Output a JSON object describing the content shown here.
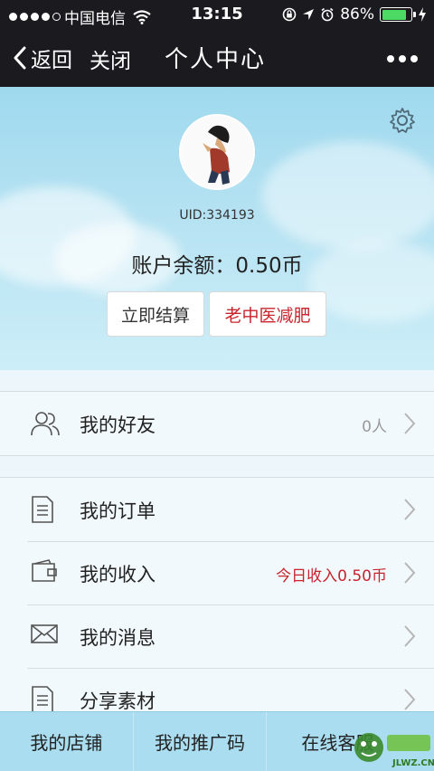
{
  "status_bar": {
    "carrier": "中国电信",
    "time": "13:15",
    "battery": "86%",
    "battery_level": 0.86
  },
  "nav": {
    "back_label": "返回",
    "close_label": "关闭",
    "title": "个人中心"
  },
  "profile": {
    "uid": "UID:334193",
    "balance": "账户余额：0.50币",
    "settle_label": "立即结算",
    "doctor_label": "老中医减肥"
  },
  "menu": {
    "friends": {
      "label": "我的好友",
      "value": "0人"
    },
    "orders": {
      "label": "我的订单"
    },
    "income": {
      "label": "我的收入",
      "value": "今日收入0.50币"
    },
    "messages": {
      "label": "我的消息"
    },
    "share": {
      "label": "分享素材"
    }
  },
  "tabs": [
    "我的店铺",
    "我的推广码",
    "在线客服"
  ],
  "watermark": {
    "text": "JLWZ.CN"
  },
  "colors": {
    "accent_red": "#c8242d",
    "tab_bg": "#a9ddef",
    "sky": "#b5e2f2"
  }
}
